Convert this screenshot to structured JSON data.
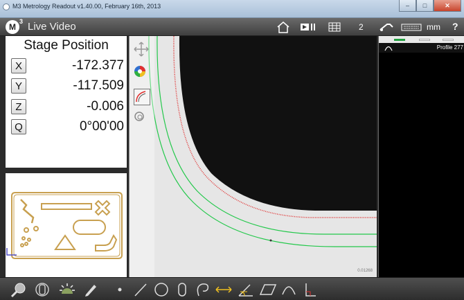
{
  "window": {
    "title": "M3 Metrology Readout  v1.40.00, February 16th, 2013",
    "min_glyph": "–",
    "max_glyph": "□",
    "close_glyph": "✕"
  },
  "header": {
    "logo_letter": "M",
    "logo_sup": "3",
    "title": "Live Video",
    "count": "2",
    "units": "mm",
    "help": "?"
  },
  "stage": {
    "title": "Stage Position",
    "axes": [
      {
        "label": "X",
        "value": "-172.377"
      },
      {
        "label": "Y",
        "value": "-117.509"
      },
      {
        "label": "Z",
        "value": "-0.006"
      },
      {
        "label": "Q",
        "value": "0°00'00"
      }
    ]
  },
  "video": {
    "scale_label": "0.01268"
  },
  "right_panel": {
    "feature_label": "Profile 277"
  },
  "colors": {
    "accent_red": "#e03030",
    "accent_green": "#22c84a",
    "part_outline": "#c8a050"
  }
}
